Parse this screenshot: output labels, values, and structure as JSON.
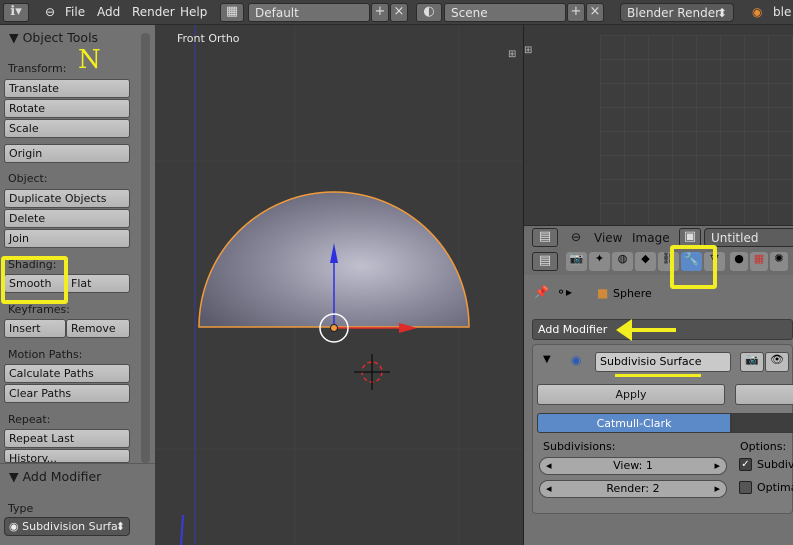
{
  "topbar": {
    "menus": [
      "File",
      "Add",
      "Render",
      "Help"
    ],
    "screen_layout": "Default",
    "scene": "Scene",
    "render_engine": "Blender Render",
    "app_label": "ble"
  },
  "shelf": {
    "panel_title": "Object Tools",
    "transform_label": "Transform:",
    "translate": "Translate",
    "rotate": "Rotate",
    "scale": "Scale",
    "origin": "Origin",
    "object_label": "Object:",
    "duplicate": "Duplicate Objects",
    "delete": "Delete",
    "join": "Join",
    "shading_label": "Shading:",
    "smooth": "Smooth",
    "flat": "Flat",
    "keyframes_label": "Keyframes:",
    "insert": "Insert",
    "remove": "Remove",
    "motion_label": "Motion Paths:",
    "calc_paths": "Calculate Paths",
    "clear_paths": "Clear Paths",
    "repeat_label": "Repeat:",
    "repeat_last": "Repeat Last",
    "history": "History...",
    "addmod_title": "Add Modifier",
    "type_label": "Type",
    "type_value": "Subdivision Surfa",
    "annotation": "N"
  },
  "viewport": {
    "view_name": "Front Ortho"
  },
  "image_header": {
    "view": "View",
    "image": "Image",
    "name": "Untitled"
  },
  "properties": {
    "object_name": "Sphere",
    "add_modifier": "Add Modifier",
    "modifier_name": "Subdivisio Surface",
    "apply": "Apply",
    "catmull": "Catmull-Clark",
    "subdivisions_label": "Subdivisions:",
    "options_label": "Options:",
    "view_level": "View: 1",
    "render_level": "Render: 2",
    "opt1": "Subdivi",
    "opt2": "Optima",
    "opt1_checked": true,
    "opt2_checked": false
  },
  "colors": {
    "highlight": "#f3ee1f",
    "active_blue": "#5c89c7",
    "selection_orange": "#f09a3c"
  },
  "icons": [
    "info-icon",
    "settings-icon",
    "minus-icon",
    "layout-icon",
    "plus-icon",
    "close-icon",
    "scene-icon",
    "camera-icon",
    "wrench-icon",
    "sphere-icon",
    "pin-icon",
    "eye-icon",
    "render-icon",
    "world-icon",
    "material-icon",
    "texture-icon",
    "particles-icon",
    "physics-icon",
    "image-icon",
    "cursor-icon"
  ]
}
